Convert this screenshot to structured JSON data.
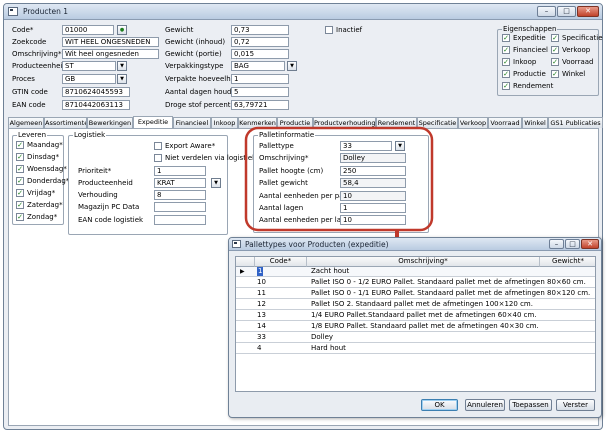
{
  "window": {
    "title": "Producten 1",
    "minimize": "–",
    "maximize": "□",
    "close": "✕"
  },
  "form": {
    "code": {
      "label": "Code*",
      "value": "01000"
    },
    "zoekcode": {
      "label": "Zoekcode",
      "value": "WIT HEEL ONGESNEDEN"
    },
    "omschrijving": {
      "label": "Omschrijving*",
      "value": "Wit heel ongesneden"
    },
    "producteenheid": {
      "label": "Producteenheid",
      "value": "ST"
    },
    "proces": {
      "label": "Proces",
      "value": "GB"
    },
    "gtin": {
      "label": "GTIN code",
      "value": "8710624045593"
    },
    "ean": {
      "label": "EAN code",
      "value": "8710442063113"
    },
    "gewicht": {
      "label": "Gewicht",
      "value": "0,73"
    },
    "gewicht_inhoud": {
      "label": "Gewicht (inhoud)",
      "value": "0,72"
    },
    "gewicht_portie": {
      "label": "Gewicht (portie)",
      "value": "0,015"
    },
    "verpakkingstype": {
      "label": "Verpakkingstype",
      "value": "BAG"
    },
    "verpakte_hoeveelheid": {
      "label": "Verpakte hoeveelheid",
      "value": "1"
    },
    "aantal_dagen": {
      "label": "Aantal dagen houdbaar",
      "value": "5"
    },
    "droge_stof": {
      "label": "Droge stof percentage",
      "value": "63,79721"
    },
    "inactief": {
      "label": "Inactief",
      "checked": false
    }
  },
  "eigenschappen": {
    "title": "Eigenschappen",
    "items": [
      {
        "label": "Expeditie",
        "checked": true
      },
      {
        "label": "Specificatie",
        "checked": true
      },
      {
        "label": "Financieel",
        "checked": true
      },
      {
        "label": "Verkoop",
        "checked": true
      },
      {
        "label": "Inkoop",
        "checked": true
      },
      {
        "label": "Voorraad",
        "checked": true
      },
      {
        "label": "Productie",
        "checked": true
      },
      {
        "label": "Winkel",
        "checked": true
      },
      {
        "label": "Rendement",
        "checked": true
      }
    ]
  },
  "tabs": [
    "Algemeen",
    "Assortimenten",
    "Bewerkingen",
    "Expeditie",
    "Financieel",
    "Inkoop",
    "Kenmerken",
    "Productie",
    "Productverhoudingen",
    "Rendement",
    "Specificatie",
    "Verkoop",
    "Voorraad",
    "Winkel",
    "GS1 Publicaties"
  ],
  "active_tab": "Expeditie",
  "leveren": {
    "title": "Leveren",
    "days": [
      {
        "label": "Maandag*",
        "checked": true
      },
      {
        "label": "Dinsdag*",
        "checked": true
      },
      {
        "label": "Woensdag*",
        "checked": true
      },
      {
        "label": "Donderdag*",
        "checked": true
      },
      {
        "label": "Vrijdag*",
        "checked": true
      },
      {
        "label": "Zaterdag*",
        "checked": true
      },
      {
        "label": "Zondag*",
        "checked": true
      }
    ]
  },
  "logistiek": {
    "title": "Logistiek",
    "export_aware": {
      "label": "Export Aware*",
      "checked": false
    },
    "niet_verdelen": {
      "label": "Niet verdelen via logistiek*",
      "checked": false
    },
    "prioriteit": {
      "label": "Prioriteit*",
      "value": "1"
    },
    "producteenheid": {
      "label": "Producteenheid",
      "value": "KRAT"
    },
    "verhouding": {
      "label": "Verhouding",
      "value": "8"
    },
    "magazijn": {
      "label": "Magazijn PC Data",
      "value": ""
    },
    "ean_logistiek": {
      "label": "EAN code logistiek",
      "value": ""
    }
  },
  "palletinformatie": {
    "title": "Palletinformatie",
    "pallettype": {
      "label": "Pallettype",
      "value": "33"
    },
    "omschrijving": {
      "label": "Omschrijving*",
      "value": "Dolley"
    },
    "hoogte": {
      "label": "Pallet hoogte (cm)",
      "value": "250"
    },
    "gewicht": {
      "label": "Pallet gewicht",
      "value": "58,4"
    },
    "per_pallet": {
      "label": "Aantal eenheden per pallet",
      "value": "10"
    },
    "lagen": {
      "label": "Aantal lagen",
      "value": "1"
    },
    "per_laag": {
      "label": "Aantal eenheden per laag",
      "value": "10"
    }
  },
  "dialog": {
    "title": "Pallettypes voor Producten (expeditie)",
    "columns": [
      "Code*",
      "Omschrijving*",
      "Gewicht*"
    ],
    "rows": [
      {
        "code": "1",
        "desc": "Zacht hout",
        "weight": ""
      },
      {
        "code": "10",
        "desc": "Pallet ISO 0 - 1/2 EURO Pallet. Standaard pallet met de afmetingen 80×60 cm.",
        "weight": ""
      },
      {
        "code": "11",
        "desc": "Pallet ISO 0 - 1/1 EURO Pallet. Standaard pallet met de afmetingen 80×120 cm.",
        "weight": ""
      },
      {
        "code": "12",
        "desc": "Pallet ISO 2. Standaard pallet met de afmetingen 100×120 cm.",
        "weight": ""
      },
      {
        "code": "13",
        "desc": "1/4 EURO Pallet.Standaard pallet met de afmetingen 60×40 cm.",
        "weight": ""
      },
      {
        "code": "14",
        "desc": "1/8 EURO Pallet. Standaard pallet met de afmetingen 40×30 cm.",
        "weight": ""
      },
      {
        "code": "33",
        "desc": "Dolley",
        "weight": ""
      },
      {
        "code": "4",
        "desc": "Hard hout",
        "weight": ""
      }
    ],
    "buttons": {
      "ok": "OK",
      "annuleren": "Annuleren",
      "toepassen": "Toepassen",
      "verster": "Verster"
    }
  },
  "colors": {
    "highlight_circle": "#c0392b",
    "arrow": "#c0392b",
    "check": "#1d7d1d"
  }
}
